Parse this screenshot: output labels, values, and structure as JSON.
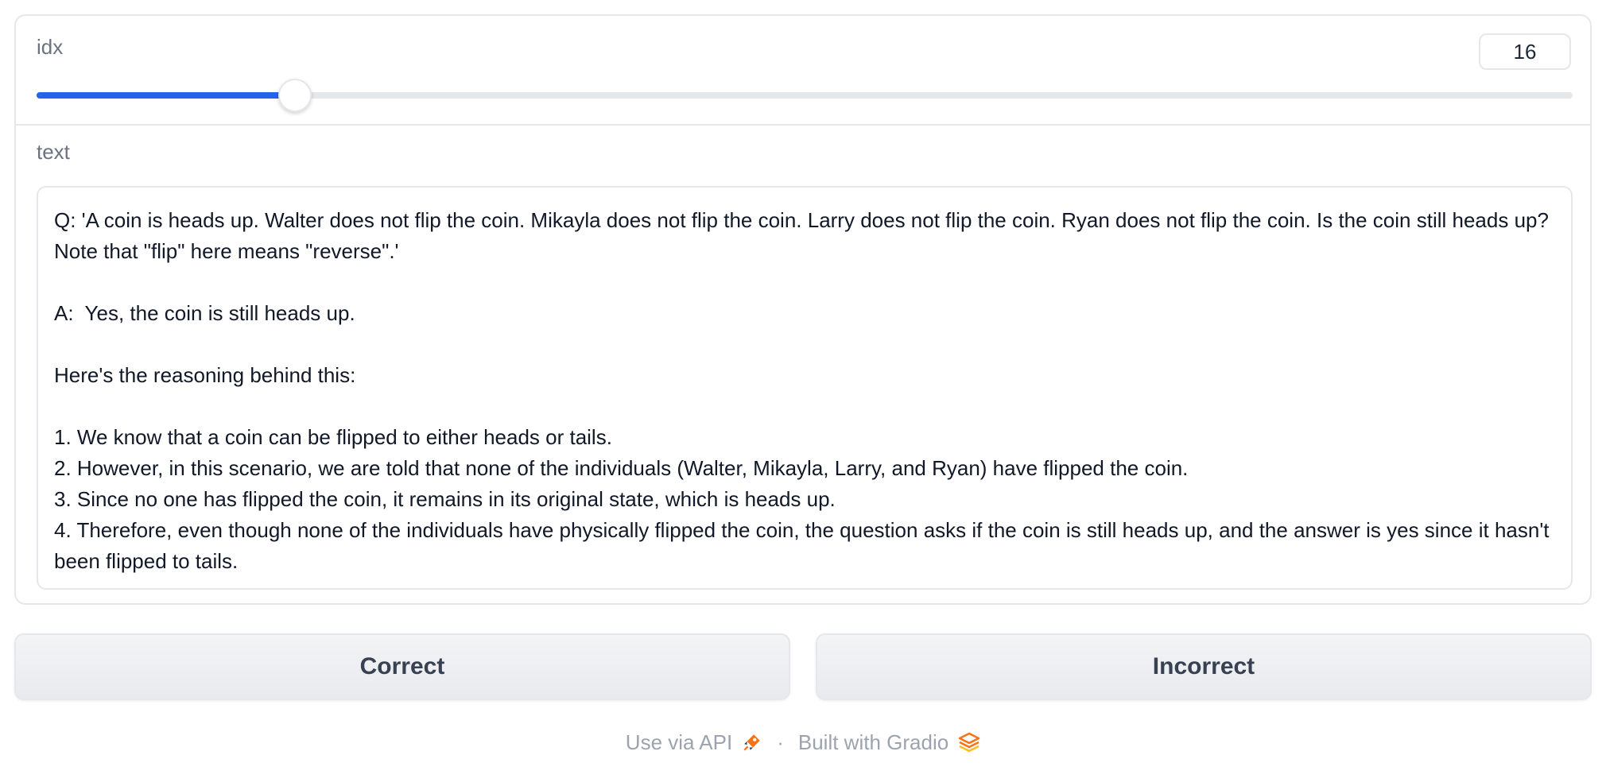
{
  "slider": {
    "label": "idx",
    "value": "16",
    "fraction": 0.167
  },
  "text": {
    "label": "text",
    "value": "Q: 'A coin is heads up. Walter does not flip the coin. Mikayla does not flip the coin. Larry does not flip the coin. Ryan does not flip the coin. Is the coin still heads up? Note that \"flip\" here means \"reverse\".'\n\nA:  Yes, the coin is still heads up.\n\nHere's the reasoning behind this:\n\n1. We know that a coin can be flipped to either heads or tails.\n2. However, in this scenario, we are told that none of the individuals (Walter, Mikayla, Larry, and Ryan) have flipped the coin.\n3. Since no one has flipped the coin, it remains in its original state, which is heads up.\n4. Therefore, even though none of the individuals have physically flipped the coin, the question asks if the coin is still heads up, and the answer is yes since it hasn't been flipped to tails."
  },
  "buttons": {
    "correct": "Correct",
    "incorrect": "Incorrect"
  },
  "footer": {
    "api_link": "Use via API",
    "separator": "·",
    "built_with": "Built with Gradio"
  },
  "colors": {
    "accent": "#2563eb",
    "gradio_orange": "#f97316"
  }
}
